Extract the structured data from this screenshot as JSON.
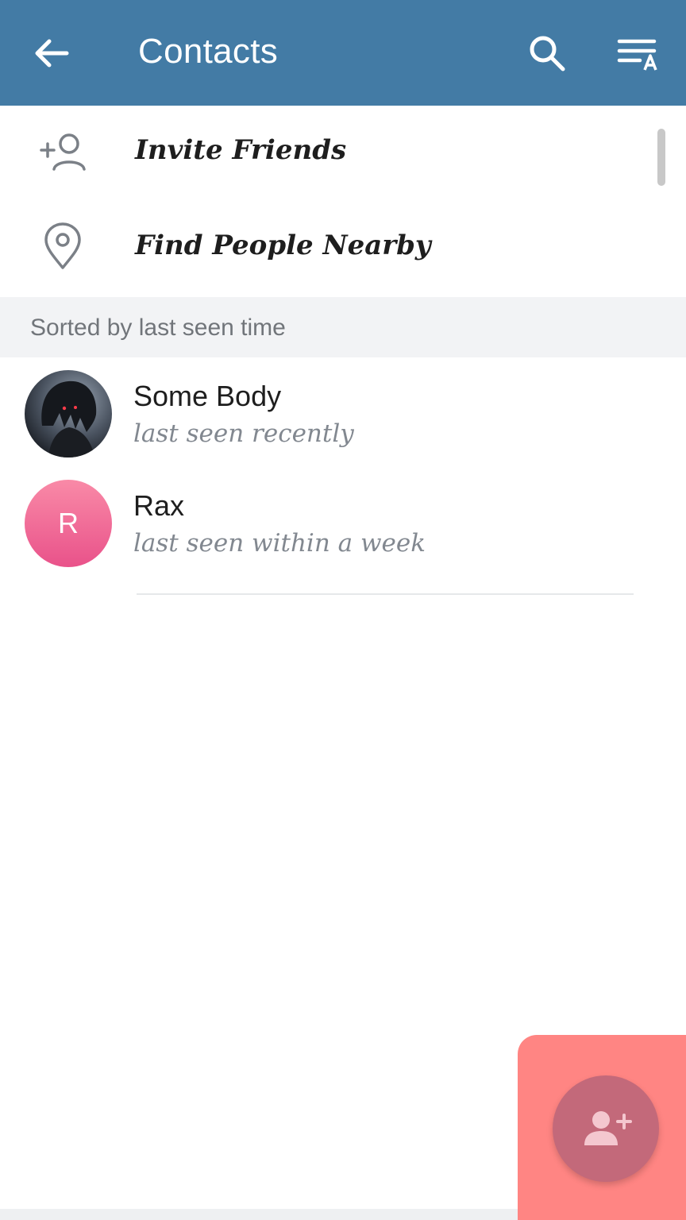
{
  "appbar": {
    "title": "Contacts",
    "back_icon": "arrow-left-icon",
    "search_icon": "search-icon",
    "sort_icon": "sort-alpha-icon",
    "background": "#437ba5"
  },
  "actions": [
    {
      "label": "Invite Friends",
      "icon": "add-person-icon"
    },
    {
      "label": "Find People Nearby",
      "icon": "location-pin-icon"
    }
  ],
  "section": {
    "header": "Sorted by last seen time"
  },
  "contacts": [
    {
      "name": "Some Body",
      "status": "last seen recently",
      "avatar": "photo"
    },
    {
      "name": "Rax",
      "status": "last seen within a week",
      "avatar_letter": "R",
      "avatar_color": "#ef6d97"
    }
  ],
  "fab": {
    "icon": "add-contact-icon",
    "color": "#c3697a",
    "highlight_color": "#ff8583"
  }
}
